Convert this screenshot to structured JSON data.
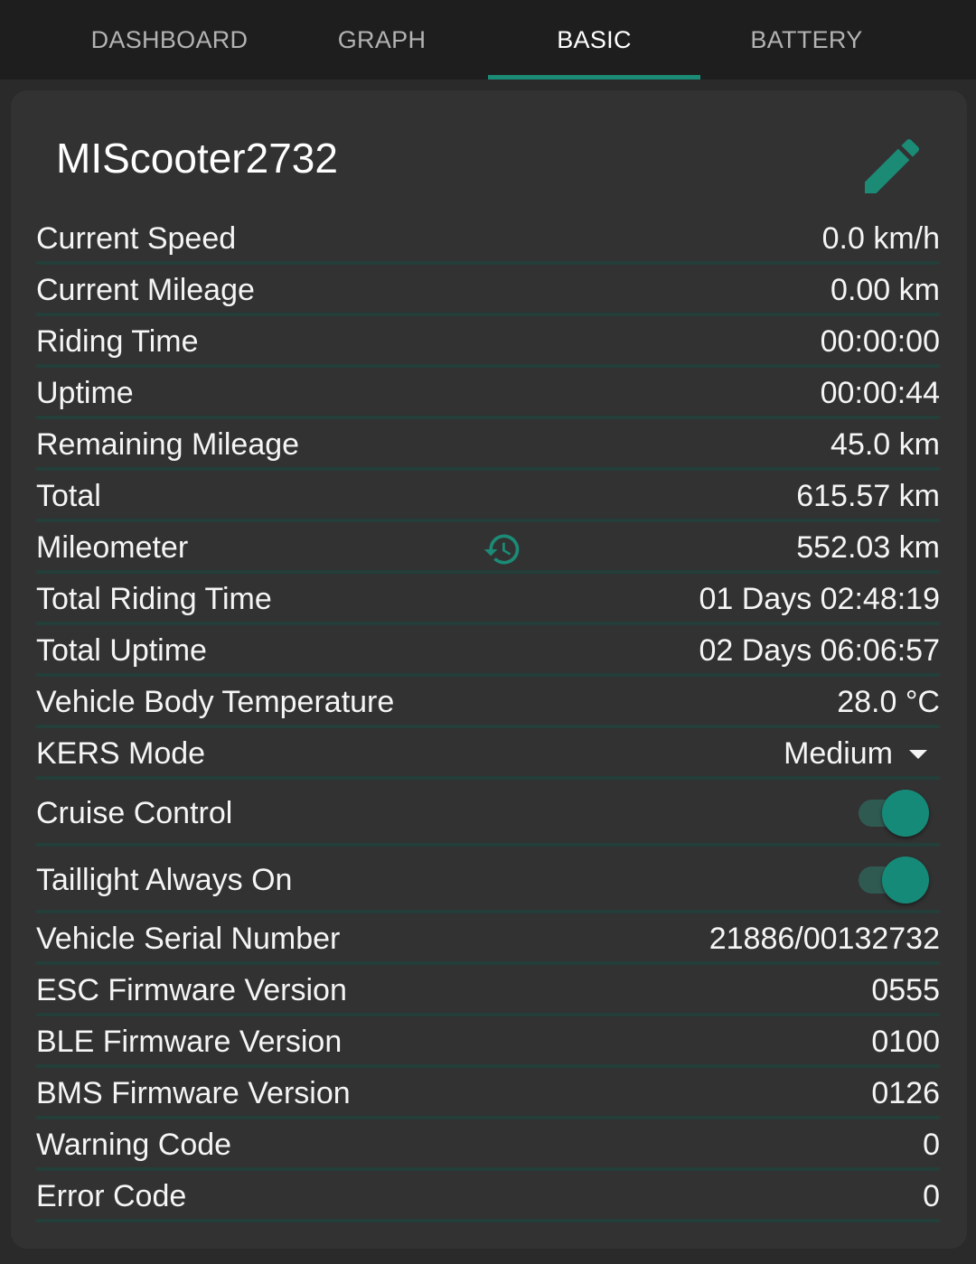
{
  "tabs": [
    {
      "label": "DASHBOARD",
      "active": false
    },
    {
      "label": "GRAPH",
      "active": false
    },
    {
      "label": "BASIC",
      "active": true
    },
    {
      "label": "BATTERY",
      "active": false
    }
  ],
  "device": {
    "name": "MIScooter2732"
  },
  "icons": {
    "edit": "pencil-icon",
    "history": "history-icon",
    "dropdown": "caret-down-icon"
  },
  "colors": {
    "accent": "#1b8b76",
    "divider": "#243e39",
    "background": "#2a2a2a",
    "card": "#323232"
  },
  "rows": [
    {
      "label": "Current Speed",
      "value": "0.0 km/h"
    },
    {
      "label": "Current Mileage",
      "value": "0.00 km"
    },
    {
      "label": "Riding Time",
      "value": "00:00:00"
    },
    {
      "label": "Uptime",
      "value": "00:00:44"
    },
    {
      "label": "Remaining Mileage",
      "value": "45.0 km"
    },
    {
      "label": "Total",
      "value": "615.57 km"
    },
    {
      "label": "Mileometer",
      "value": "552.03 km"
    },
    {
      "label": "Total Riding Time",
      "value": "01 Days 02:48:19"
    },
    {
      "label": "Total Uptime",
      "value": "02 Days 06:06:57"
    },
    {
      "label": "Vehicle Body Temperature",
      "value": "28.0 °C"
    },
    {
      "label": "KERS Mode",
      "value": "Medium"
    },
    {
      "label": "Cruise Control",
      "value": true
    },
    {
      "label": "Taillight Always On",
      "value": true
    },
    {
      "label": "Vehicle Serial Number",
      "value": "21886/00132732"
    },
    {
      "label": "ESC Firmware Version",
      "value": "0555"
    },
    {
      "label": "BLE Firmware Version",
      "value": "0100"
    },
    {
      "label": "BMS Firmware Version",
      "value": "0126"
    },
    {
      "label": "Warning Code",
      "value": "0"
    },
    {
      "label": "Error Code",
      "value": "0"
    }
  ]
}
